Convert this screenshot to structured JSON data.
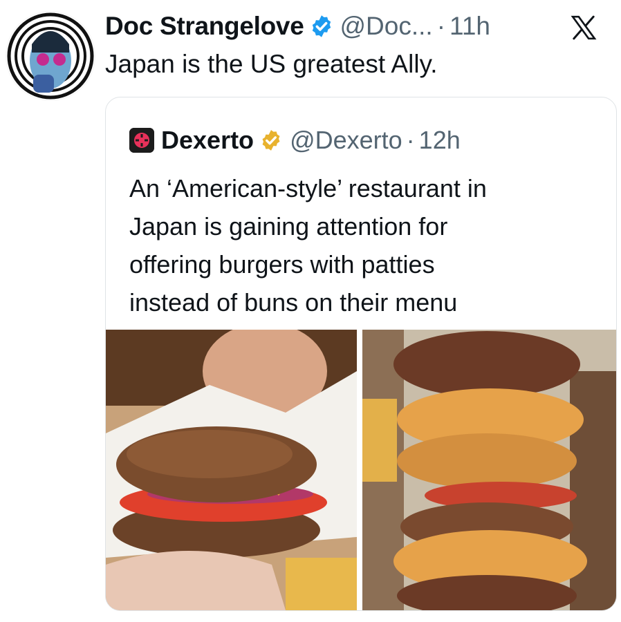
{
  "post": {
    "author_name": "Doc Strangelove",
    "handle": "@Doc...",
    "separator": "·",
    "time": "11h",
    "text": "Japan is the US greatest Ally."
  },
  "quoted": {
    "author_name": "Dexerto",
    "handle": "@Dexerto",
    "separator": "·",
    "time": "12h",
    "text_lines": [
      "An ‘American-style’ restaurant in",
      "Japan is gaining attention for",
      "offering burgers with patties",
      "instead of buns on their menu"
    ]
  },
  "icons": {
    "verified": "verified-badge-icon",
    "gold": "gold-verified-badge-icon",
    "logo": "x-logo-icon"
  },
  "colors": {
    "verified_blue": "#1d9bf0",
    "gold": "#e8b22e",
    "muted_text": "#536471",
    "dexerto_red": "#e8315a"
  }
}
